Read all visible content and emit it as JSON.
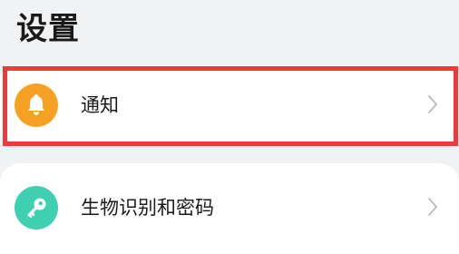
{
  "page": {
    "title": "设置"
  },
  "settings": {
    "items": [
      {
        "label": "通知",
        "icon": "bell-icon",
        "icon_bg": "#f6a123",
        "highlighted": true
      },
      {
        "label": "生物识别和密码",
        "icon": "key-icon",
        "icon_bg": "#3fcfb1",
        "highlighted": false
      }
    ]
  },
  "colors": {
    "page_bg": "#f1f2f4",
    "card_bg": "#ffffff",
    "highlight": "#f03a3a",
    "chevron": "#bdbdbd"
  }
}
